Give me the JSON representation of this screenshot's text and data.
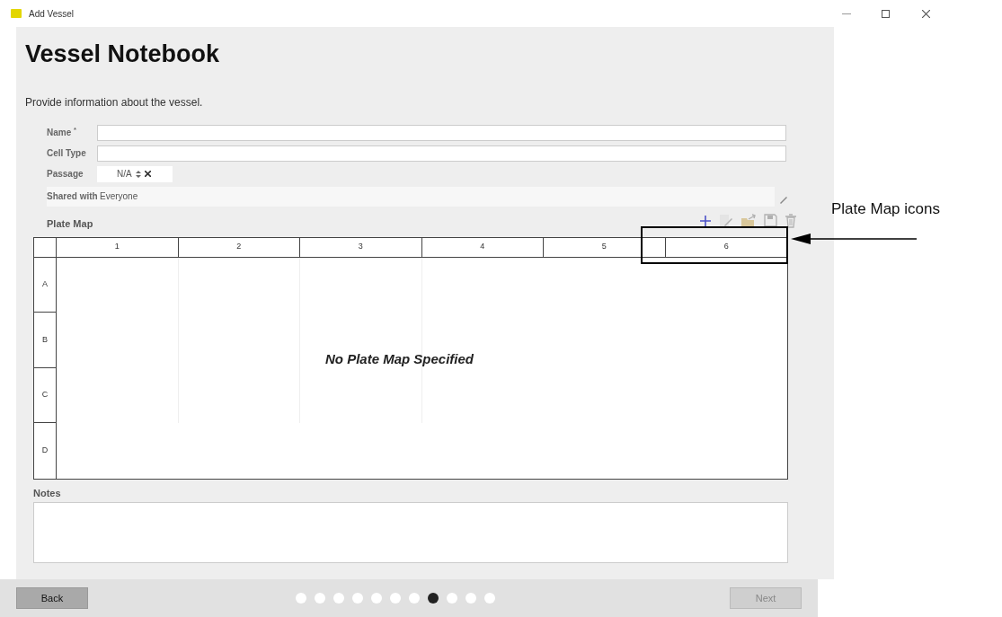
{
  "window": {
    "title": "Add Vessel"
  },
  "heading": "Vessel Notebook",
  "subtitle": "Provide information about the vessel.",
  "fields": [
    {
      "label": "Name $^{*}$",
      "kind": "text"
    },
    {
      "label": "Cell Type",
      "kind": "text"
    },
    {
      "label": "Passage",
      "kind": "spinner",
      "value": "N/A"
    },
    {
      "label": "Shared with",
      "kind": "static",
      "value": "Everyone"
    }
  ],
  "plate_map": {
    "label": "Plate Map",
    "toolbar": [
      {
        "kind": "add",
        "disabled": false
      },
      {
        "kind": "edit",
        "disabled": true
      },
      {
        "kind": "import",
        "disabled": true
      },
      {
        "kind": "save",
        "disabled": true
      },
      {
        "kind": "delete",
        "disabled": true
      }
    ],
    "columns": [
      "1",
      "2",
      "3",
      "4",
      "5",
      "6"
    ],
    "rows": [
      "A",
      "B",
      "C",
      "D"
    ],
    "empty_message": "No Plate Map Specified"
  },
  "notes": {
    "label": "Notes"
  },
  "footer": {
    "back": {
      "label": "Back",
      "disabled": false
    },
    "next": {
      "label": "Next",
      "disabled": true
    },
    "steps": [
      {
        "selected": false
      },
      {
        "selected": false
      },
      {
        "selected": false
      },
      {
        "selected": false
      },
      {
        "selected": false
      },
      {
        "selected": false
      },
      {
        "selected": false
      },
      {
        "selected": true
      },
      {
        "selected": false
      },
      {
        "selected": false
      },
      {
        "selected": false
      }
    ]
  },
  "callout": {
    "text": "Plate Map icons"
  }
}
